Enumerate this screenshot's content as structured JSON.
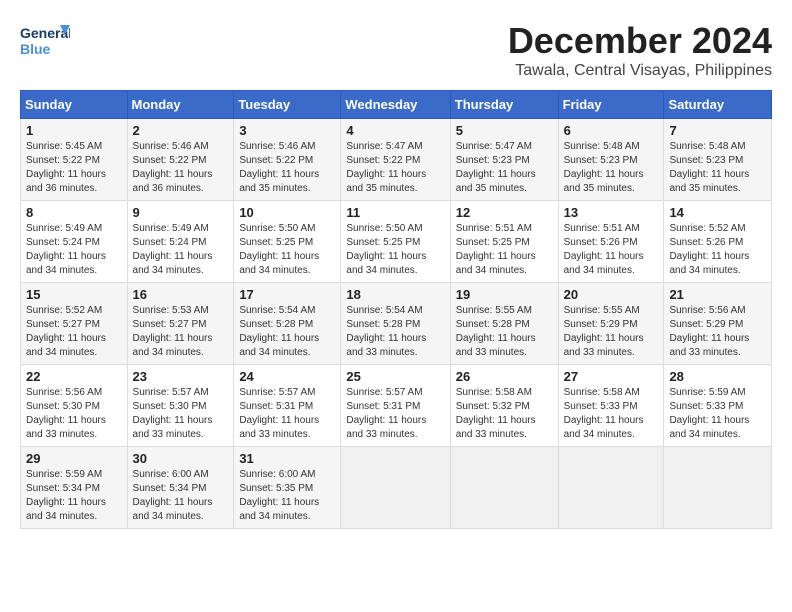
{
  "logo": {
    "general": "General",
    "blue": "Blue"
  },
  "title": "December 2024",
  "location": "Tawala, Central Visayas, Philippines",
  "days_of_week": [
    "Sunday",
    "Monday",
    "Tuesday",
    "Wednesday",
    "Thursday",
    "Friday",
    "Saturday"
  ],
  "weeks": [
    [
      {
        "day": "1",
        "sunrise": "5:45 AM",
        "sunset": "5:22 PM",
        "daylight": "11 hours and 36 minutes."
      },
      {
        "day": "2",
        "sunrise": "5:46 AM",
        "sunset": "5:22 PM",
        "daylight": "11 hours and 36 minutes."
      },
      {
        "day": "3",
        "sunrise": "5:46 AM",
        "sunset": "5:22 PM",
        "daylight": "11 hours and 35 minutes."
      },
      {
        "day": "4",
        "sunrise": "5:47 AM",
        "sunset": "5:22 PM",
        "daylight": "11 hours and 35 minutes."
      },
      {
        "day": "5",
        "sunrise": "5:47 AM",
        "sunset": "5:23 PM",
        "daylight": "11 hours and 35 minutes."
      },
      {
        "day": "6",
        "sunrise": "5:48 AM",
        "sunset": "5:23 PM",
        "daylight": "11 hours and 35 minutes."
      },
      {
        "day": "7",
        "sunrise": "5:48 AM",
        "sunset": "5:23 PM",
        "daylight": "11 hours and 35 minutes."
      }
    ],
    [
      {
        "day": "8",
        "sunrise": "5:49 AM",
        "sunset": "5:24 PM",
        "daylight": "11 hours and 34 minutes."
      },
      {
        "day": "9",
        "sunrise": "5:49 AM",
        "sunset": "5:24 PM",
        "daylight": "11 hours and 34 minutes."
      },
      {
        "day": "10",
        "sunrise": "5:50 AM",
        "sunset": "5:25 PM",
        "daylight": "11 hours and 34 minutes."
      },
      {
        "day": "11",
        "sunrise": "5:50 AM",
        "sunset": "5:25 PM",
        "daylight": "11 hours and 34 minutes."
      },
      {
        "day": "12",
        "sunrise": "5:51 AM",
        "sunset": "5:25 PM",
        "daylight": "11 hours and 34 minutes."
      },
      {
        "day": "13",
        "sunrise": "5:51 AM",
        "sunset": "5:26 PM",
        "daylight": "11 hours and 34 minutes."
      },
      {
        "day": "14",
        "sunrise": "5:52 AM",
        "sunset": "5:26 PM",
        "daylight": "11 hours and 34 minutes."
      }
    ],
    [
      {
        "day": "15",
        "sunrise": "5:52 AM",
        "sunset": "5:27 PM",
        "daylight": "11 hours and 34 minutes."
      },
      {
        "day": "16",
        "sunrise": "5:53 AM",
        "sunset": "5:27 PM",
        "daylight": "11 hours and 34 minutes."
      },
      {
        "day": "17",
        "sunrise": "5:54 AM",
        "sunset": "5:28 PM",
        "daylight": "11 hours and 34 minutes."
      },
      {
        "day": "18",
        "sunrise": "5:54 AM",
        "sunset": "5:28 PM",
        "daylight": "11 hours and 33 minutes."
      },
      {
        "day": "19",
        "sunrise": "5:55 AM",
        "sunset": "5:28 PM",
        "daylight": "11 hours and 33 minutes."
      },
      {
        "day": "20",
        "sunrise": "5:55 AM",
        "sunset": "5:29 PM",
        "daylight": "11 hours and 33 minutes."
      },
      {
        "day": "21",
        "sunrise": "5:56 AM",
        "sunset": "5:29 PM",
        "daylight": "11 hours and 33 minutes."
      }
    ],
    [
      {
        "day": "22",
        "sunrise": "5:56 AM",
        "sunset": "5:30 PM",
        "daylight": "11 hours and 33 minutes."
      },
      {
        "day": "23",
        "sunrise": "5:57 AM",
        "sunset": "5:30 PM",
        "daylight": "11 hours and 33 minutes."
      },
      {
        "day": "24",
        "sunrise": "5:57 AM",
        "sunset": "5:31 PM",
        "daylight": "11 hours and 33 minutes."
      },
      {
        "day": "25",
        "sunrise": "5:57 AM",
        "sunset": "5:31 PM",
        "daylight": "11 hours and 33 minutes."
      },
      {
        "day": "26",
        "sunrise": "5:58 AM",
        "sunset": "5:32 PM",
        "daylight": "11 hours and 33 minutes."
      },
      {
        "day": "27",
        "sunrise": "5:58 AM",
        "sunset": "5:33 PM",
        "daylight": "11 hours and 34 minutes."
      },
      {
        "day": "28",
        "sunrise": "5:59 AM",
        "sunset": "5:33 PM",
        "daylight": "11 hours and 34 minutes."
      }
    ],
    [
      {
        "day": "29",
        "sunrise": "5:59 AM",
        "sunset": "5:34 PM",
        "daylight": "11 hours and 34 minutes."
      },
      {
        "day": "30",
        "sunrise": "6:00 AM",
        "sunset": "5:34 PM",
        "daylight": "11 hours and 34 minutes."
      },
      {
        "day": "31",
        "sunrise": "6:00 AM",
        "sunset": "5:35 PM",
        "daylight": "11 hours and 34 minutes."
      },
      null,
      null,
      null,
      null
    ]
  ],
  "labels": {
    "sunrise": "Sunrise:",
    "sunset": "Sunset:",
    "daylight": "Daylight:"
  }
}
